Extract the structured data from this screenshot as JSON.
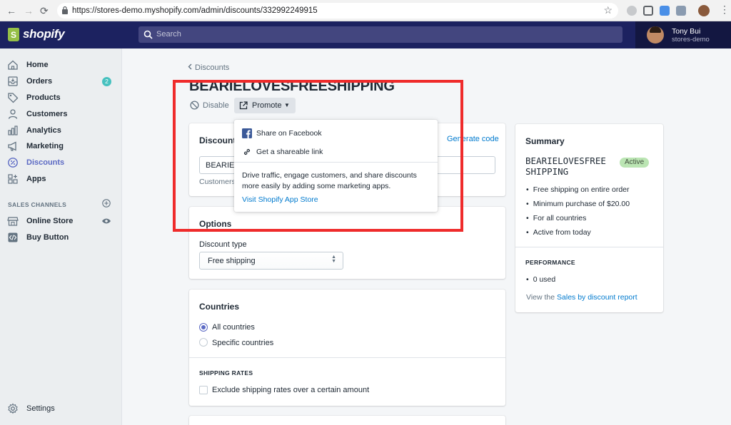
{
  "browser": {
    "url": "https://stores-demo.myshopify.com/admin/discounts/332992249915",
    "back": "←",
    "forward": "→",
    "reload": "⟳",
    "star": "☆",
    "menu": "⋮"
  },
  "topbar": {
    "logo_text": "shopify",
    "search_placeholder": "Search",
    "user_name": "Tony Bui",
    "store_name": "stores-demo"
  },
  "sidebar": {
    "items": [
      {
        "label": "Home",
        "icon": "home-icon"
      },
      {
        "label": "Orders",
        "icon": "orders-icon",
        "badge": "2"
      },
      {
        "label": "Products",
        "icon": "tag-icon"
      },
      {
        "label": "Customers",
        "icon": "person-icon"
      },
      {
        "label": "Analytics",
        "icon": "bar-chart-icon"
      },
      {
        "label": "Marketing",
        "icon": "megaphone-icon"
      },
      {
        "label": "Discounts",
        "icon": "discount-icon",
        "active": true
      },
      {
        "label": "Apps",
        "icon": "apps-icon"
      }
    ],
    "sales_channels_heading": "SALES CHANNELS",
    "channels": [
      {
        "label": "Online Store",
        "icon": "store-icon"
      },
      {
        "label": "Buy Button",
        "icon": "code-icon"
      }
    ],
    "settings_label": "Settings"
  },
  "main": {
    "breadcrumb": "Discounts",
    "title": "BEARIELOVESFREESHIPPING",
    "disable_label": "Disable",
    "promote_label": "Promote",
    "code_card": {
      "title": "Discount",
      "generate_link": "Generate code",
      "input_value": "BEARIEL",
      "helptext": "Customers"
    },
    "options_card": {
      "title": "Options",
      "discount_type_label": "Discount type",
      "discount_type_value": "Free shipping"
    },
    "countries_card": {
      "title": "Countries",
      "options": [
        {
          "label": "All countries",
          "checked": true
        },
        {
          "label": "Specific countries",
          "checked": false
        }
      ],
      "shipping_rates_heading": "SHIPPING RATES",
      "exclude_label": "Exclude shipping rates over a certain amount"
    }
  },
  "summary": {
    "title": "Summary",
    "code": "BEARIELOVESFREE SHIPPING",
    "status": "Active",
    "bullets": [
      "Free shipping on entire order",
      "Minimum purchase of $20.00",
      "For all countries",
      "Active from today"
    ],
    "performance_heading": "PERFORMANCE",
    "used": "0 used",
    "view_prefix": "View the",
    "report_link": "Sales by discount report"
  },
  "popover": {
    "share_facebook": "Share on Facebook",
    "shareable_link": "Get a shareable link",
    "description": "Drive traffic, engage customers, and share discounts more easily by adding some marketing apps.",
    "app_store_link": "Visit Shopify App Store"
  },
  "colors": {
    "topbar": "#1c2260",
    "accent": "#5c6ac4",
    "link": "#007ace",
    "highlight": "#ef2b2b",
    "badge_active": "#bbe5b3"
  }
}
